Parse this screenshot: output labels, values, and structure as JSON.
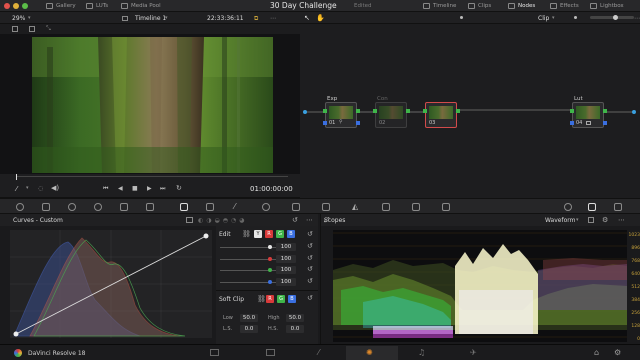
{
  "topbar": {
    "gallery": "Gallery",
    "luts": "LUTs",
    "media_pool": "Media Pool",
    "project_title": "30 Day Challenge",
    "edited": "Edited",
    "timeline": "Timeline",
    "clips": "Clips",
    "nodes": "Nodes",
    "effects": "Effects",
    "lightbox": "Lightbox"
  },
  "viewer": {
    "zoom": "29%",
    "timeline_name": "Timeline 1",
    "timecode": "22:33:36:11",
    "current_time": "01:00:00:00"
  },
  "node_editor": {
    "mode": "Clip",
    "nodes": [
      {
        "label": "Exp",
        "id": "01"
      },
      {
        "label": "Con",
        "id": "02"
      },
      {
        "label": "",
        "id": "03"
      },
      {
        "label": "Lut",
        "id": "04"
      }
    ]
  },
  "curves": {
    "title": "Curves - Custom",
    "edit_label": "Edit",
    "channels": [
      {
        "value": "100",
        "color": "#e6e6e6"
      },
      {
        "value": "100",
        "color": "#d93a3a"
      },
      {
        "value": "100",
        "color": "#3fb54a"
      },
      {
        "value": "100",
        "color": "#3a6fe0"
      }
    ],
    "soft_clip": "Soft Clip",
    "low_label": "Low",
    "low_value": "50.0",
    "high_label": "High",
    "high_value": "50.0",
    "ls_label": "L.S.",
    "ls_value": "0.0",
    "hs_label": "H.S.",
    "hs_value": "0.0"
  },
  "scopes": {
    "title": "Scopes",
    "type": "Waveform",
    "scale": [
      "1023",
      "896",
      "768",
      "640",
      "512",
      "384",
      "256",
      "128",
      "0"
    ]
  },
  "bottombar": {
    "app_name": "DaVinci Resolve 18"
  },
  "colors": {
    "accent": "#c8a23a",
    "selected_node": "#d24b4b",
    "active_page": "#e08a2a"
  }
}
